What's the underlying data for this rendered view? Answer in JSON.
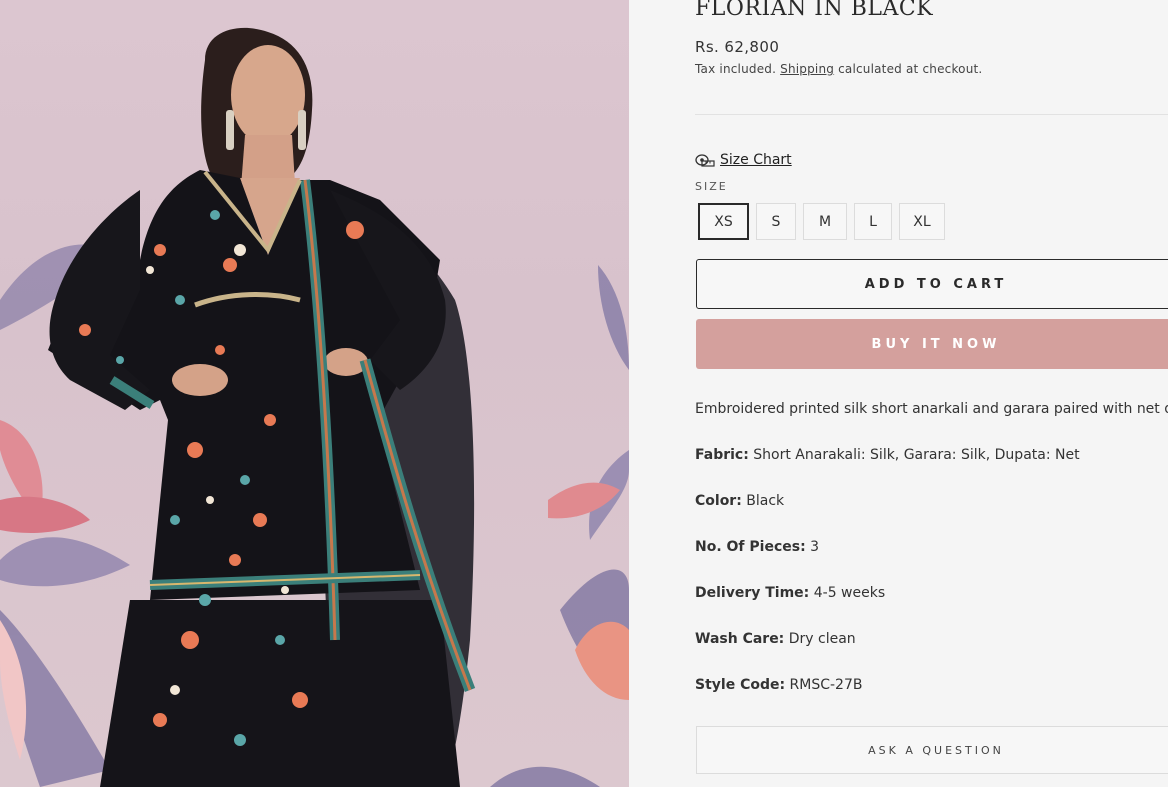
{
  "product": {
    "title": "FLORIAN IN BLACK",
    "price": "Rs. 62,800",
    "tax_prefix": "Tax included.",
    "shipping_link": "Shipping",
    "tax_suffix": "calculated at checkout.",
    "image_alt": "Model wearing black floral printed short anarkali with garara and net dupatta"
  },
  "size_chart": {
    "icon": "measuring-tape-icon",
    "label": "Size Chart"
  },
  "size_section": {
    "label": "SIZE",
    "options": [
      "XS",
      "S",
      "M",
      "L",
      "XL"
    ],
    "selected": "XS"
  },
  "actions": {
    "add_to_cart": "ADD TO CART",
    "buy_now": "BUY IT NOW",
    "ask_question": "ASK A QUESTION"
  },
  "description": "Embroidered printed silk short anarkali and garara paired with net dupatta.",
  "specs": [
    {
      "label": "Fabric:",
      "value": "Short Anarakali: Silk, Garara: Silk, Dupata: Net"
    },
    {
      "label": "Color:",
      "value": "Black"
    },
    {
      "label": "No. Of Pieces:",
      "value": "3"
    },
    {
      "label": "Delivery Time:",
      "value": "4-5 weeks"
    },
    {
      "label": "Wash Care:",
      "value": "Dry clean"
    },
    {
      "label": "Style Code:",
      "value": "RMSC-27B"
    }
  ],
  "colors": {
    "buy_now_bg": "#d4a09d",
    "page_bg": "#f5f5f5",
    "image_backdrop": "#dcc6d0"
  }
}
